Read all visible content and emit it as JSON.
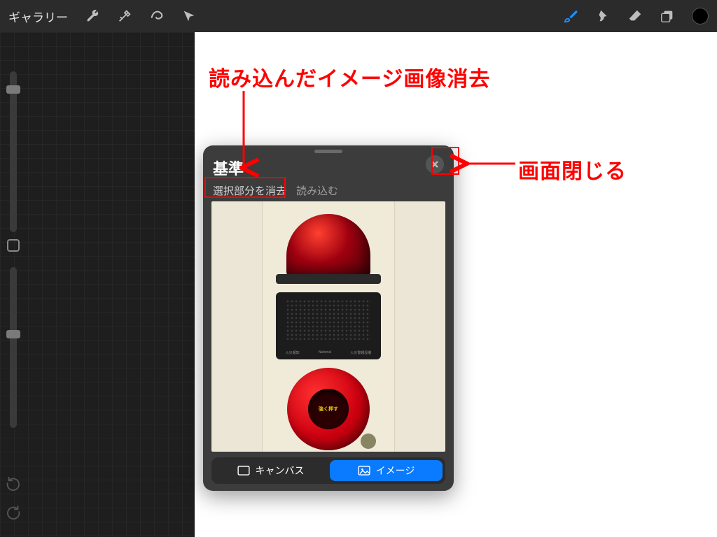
{
  "topbar": {
    "gallery": "ギャラリー"
  },
  "ref_panel": {
    "title": "基準",
    "clear_selection": "選択部分を消去",
    "load": "読み込む",
    "button_inner_text": "強く押す",
    "footer": {
      "canvas": "キャンバス",
      "image": "イメージ"
    }
  },
  "annotations": {
    "top": "読み込んだイメージ画像消去",
    "right": "画面閉じる"
  },
  "colors": {
    "annotation": "#ff0000",
    "accent": "#0a7aff"
  }
}
